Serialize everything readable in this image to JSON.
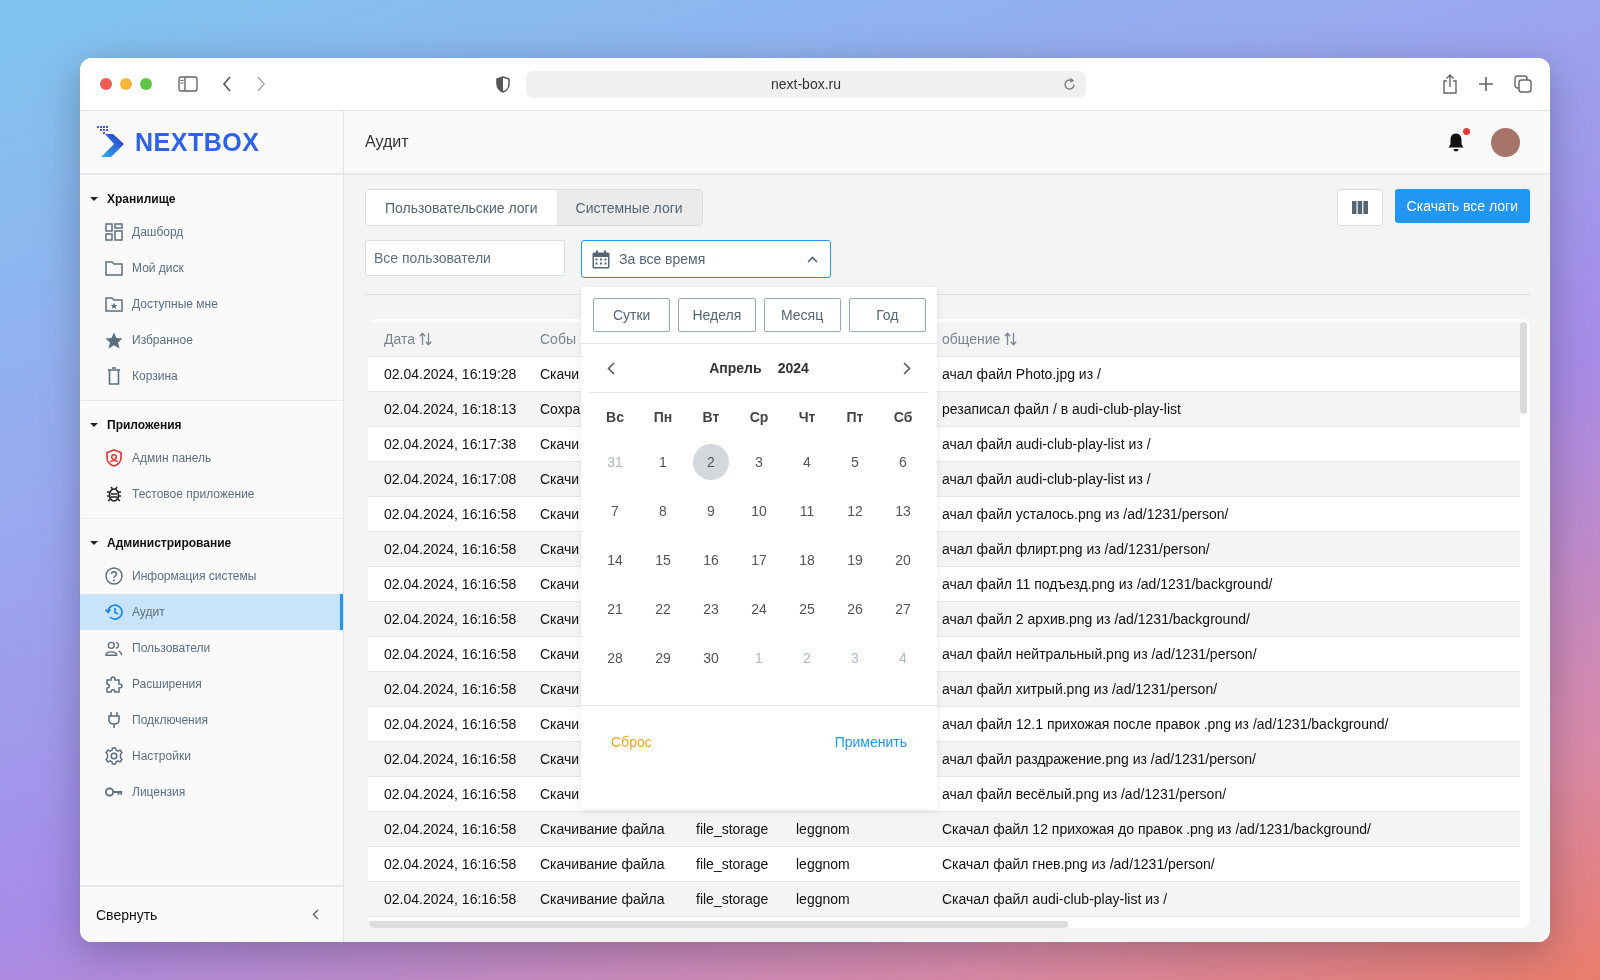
{
  "browser": {
    "url": "next-box.ru"
  },
  "sidebar": {
    "logo": "NEXTBOX",
    "sections": [
      {
        "title": "Хранилище",
        "expanded": true,
        "items": [
          {
            "label": "Дашборд",
            "selected": false
          },
          {
            "label": "Мой диск",
            "selected": false
          },
          {
            "label": "Доступные мне",
            "selected": false
          },
          {
            "label": "Избранное",
            "selected": false
          },
          {
            "label": "Корзина",
            "selected": false
          }
        ]
      },
      {
        "title": "Приложения",
        "expanded": true,
        "items": [
          {
            "label": "Админ панель",
            "selected": false
          },
          {
            "label": "Тестовое приложение",
            "selected": false
          }
        ]
      },
      {
        "title": "Администрирование",
        "expanded": true,
        "items": [
          {
            "label": "Информация системы",
            "selected": false
          },
          {
            "label": "Аудит",
            "selected": true
          },
          {
            "label": "Пользователи",
            "selected": false
          },
          {
            "label": "Расширения",
            "selected": false
          },
          {
            "label": "Подключения",
            "selected": false
          },
          {
            "label": "Настройки",
            "selected": false
          },
          {
            "label": "Лицензия",
            "selected": false
          }
        ]
      }
    ],
    "collapse": "Свернуть"
  },
  "header": {
    "title": "Аудит",
    "notifications_unread": true
  },
  "tabs": [
    {
      "label": "Пользовательские логи",
      "selected": true
    },
    {
      "label": "Системные логи",
      "selected": false
    }
  ],
  "download_button": "Скачать все логи",
  "filters": {
    "users": {
      "placeholder": "Все пользователи"
    },
    "period": {
      "value": "За все время",
      "expanded": true
    }
  },
  "calendar": {
    "presets": [
      "Сутки",
      "Неделя",
      "Месяц",
      "Год"
    ],
    "month": "Апрель",
    "year": "2024",
    "weekdays": [
      "Вс",
      "Пн",
      "Вт",
      "Ср",
      "Чт",
      "Пт",
      "Сб"
    ],
    "weeks": [
      [
        {
          "label": "31",
          "outside": true,
          "selected": false
        },
        {
          "label": "1",
          "outside": false,
          "selected": false
        },
        {
          "label": "2",
          "outside": false,
          "selected": true
        },
        {
          "label": "3",
          "outside": false,
          "selected": false
        },
        {
          "label": "4",
          "outside": false,
          "selected": false
        },
        {
          "label": "5",
          "outside": false,
          "selected": false
        },
        {
          "label": "6",
          "outside": false,
          "selected": false
        }
      ],
      [
        {
          "label": "7",
          "outside": false,
          "selected": false
        },
        {
          "label": "8",
          "outside": false,
          "selected": false
        },
        {
          "label": "9",
          "outside": false,
          "selected": false
        },
        {
          "label": "10",
          "outside": false,
          "selected": false
        },
        {
          "label": "11",
          "outside": false,
          "selected": false
        },
        {
          "label": "12",
          "outside": false,
          "selected": false
        },
        {
          "label": "13",
          "outside": false,
          "selected": false
        }
      ],
      [
        {
          "label": "14",
          "outside": false,
          "selected": false
        },
        {
          "label": "15",
          "outside": false,
          "selected": false
        },
        {
          "label": "16",
          "outside": false,
          "selected": false
        },
        {
          "label": "17",
          "outside": false,
          "selected": false
        },
        {
          "label": "18",
          "outside": false,
          "selected": false
        },
        {
          "label": "19",
          "outside": false,
          "selected": false
        },
        {
          "label": "20",
          "outside": false,
          "selected": false
        }
      ],
      [
        {
          "label": "21",
          "outside": false,
          "selected": false
        },
        {
          "label": "22",
          "outside": false,
          "selected": false
        },
        {
          "label": "23",
          "outside": false,
          "selected": false
        },
        {
          "label": "24",
          "outside": false,
          "selected": false
        },
        {
          "label": "25",
          "outside": false,
          "selected": false
        },
        {
          "label": "26",
          "outside": false,
          "selected": false
        },
        {
          "label": "27",
          "outside": false,
          "selected": false
        }
      ],
      [
        {
          "label": "28",
          "outside": false,
          "selected": false
        },
        {
          "label": "29",
          "outside": false,
          "selected": false
        },
        {
          "label": "30",
          "outside": false,
          "selected": false
        },
        {
          "label": "1",
          "outside": true,
          "selected": false
        },
        {
          "label": "2",
          "outside": true,
          "selected": false
        },
        {
          "label": "3",
          "outside": true,
          "selected": false
        },
        {
          "label": "4",
          "outside": true,
          "selected": false
        }
      ]
    ],
    "reset": "Сброс",
    "apply": "Применить"
  },
  "table": {
    "columns": [
      {
        "label": "Дата",
        "sortable": true
      },
      {
        "label": "Собы",
        "sortable": false
      },
      {
        "label": "общение",
        "sortable": true
      }
    ],
    "rows": [
      {
        "date": "02.04.2024, 16:19:28",
        "event": "Скачи",
        "message": "ачал файл Photo.jpg из /"
      },
      {
        "date": "02.04.2024, 16:18:13",
        "event": "Сохра",
        "message": "резаписал файл / в audi-club-play-list"
      },
      {
        "date": "02.04.2024, 16:17:38",
        "event": "Скачи",
        "message": "ачал файл audi-club-play-list из /"
      },
      {
        "date": "02.04.2024, 16:17:08",
        "event": "Скачи",
        "message": "ачал файл audi-club-play-list из /"
      },
      {
        "date": "02.04.2024, 16:16:58",
        "event": "Скачи",
        "message": "ачал файл усталось.png из /ad/1231/person/"
      },
      {
        "date": "02.04.2024, 16:16:58",
        "event": "Скачи",
        "message": "ачал файл флирт.png из /ad/1231/person/"
      },
      {
        "date": "02.04.2024, 16:16:58",
        "event": "Скачи",
        "message": "ачал файл 11 подъезд.png из /ad/1231/background/"
      },
      {
        "date": "02.04.2024, 16:16:58",
        "event": "Скачи",
        "message": "ачал файл 2 архив.png из /ad/1231/background/"
      },
      {
        "date": "02.04.2024, 16:16:58",
        "event": "Скачи",
        "message": "ачал файл нейтральный.png из /ad/1231/person/"
      },
      {
        "date": "02.04.2024, 16:16:58",
        "event": "Скачи",
        "message": "ачал файл хитрый.png из /ad/1231/person/"
      },
      {
        "date": "02.04.2024, 16:16:58",
        "event": "Скачи",
        "message": "ачал файл 12.1 прихожая после правок .png из /ad/1231/background/"
      },
      {
        "date": "02.04.2024, 16:16:58",
        "event": "Скачи",
        "message": "ачал файл раздражение.png из /ad/1231/person/"
      },
      {
        "date": "02.04.2024, 16:16:58",
        "event": "Скачи",
        "message": "ачал файл весёлый.png из /ad/1231/person/"
      },
      {
        "date": "02.04.2024, 16:16:58",
        "event": "Скачивание файла",
        "source": "file_storage",
        "user": "leggnom",
        "message": "Скачал файл 12 прихожая до правок .png из /ad/1231/background/"
      },
      {
        "date": "02.04.2024, 16:16:58",
        "event": "Скачивание файла",
        "source": "file_storage",
        "user": "leggnom",
        "message": "Скачал файл гнев.png из /ad/1231/person/"
      },
      {
        "date": "02.04.2024, 16:16:58",
        "event": "Скачивание файла",
        "source": "file_storage",
        "user": "leggnom",
        "message": "Скачал файл audi-club-play-list из /"
      }
    ]
  }
}
